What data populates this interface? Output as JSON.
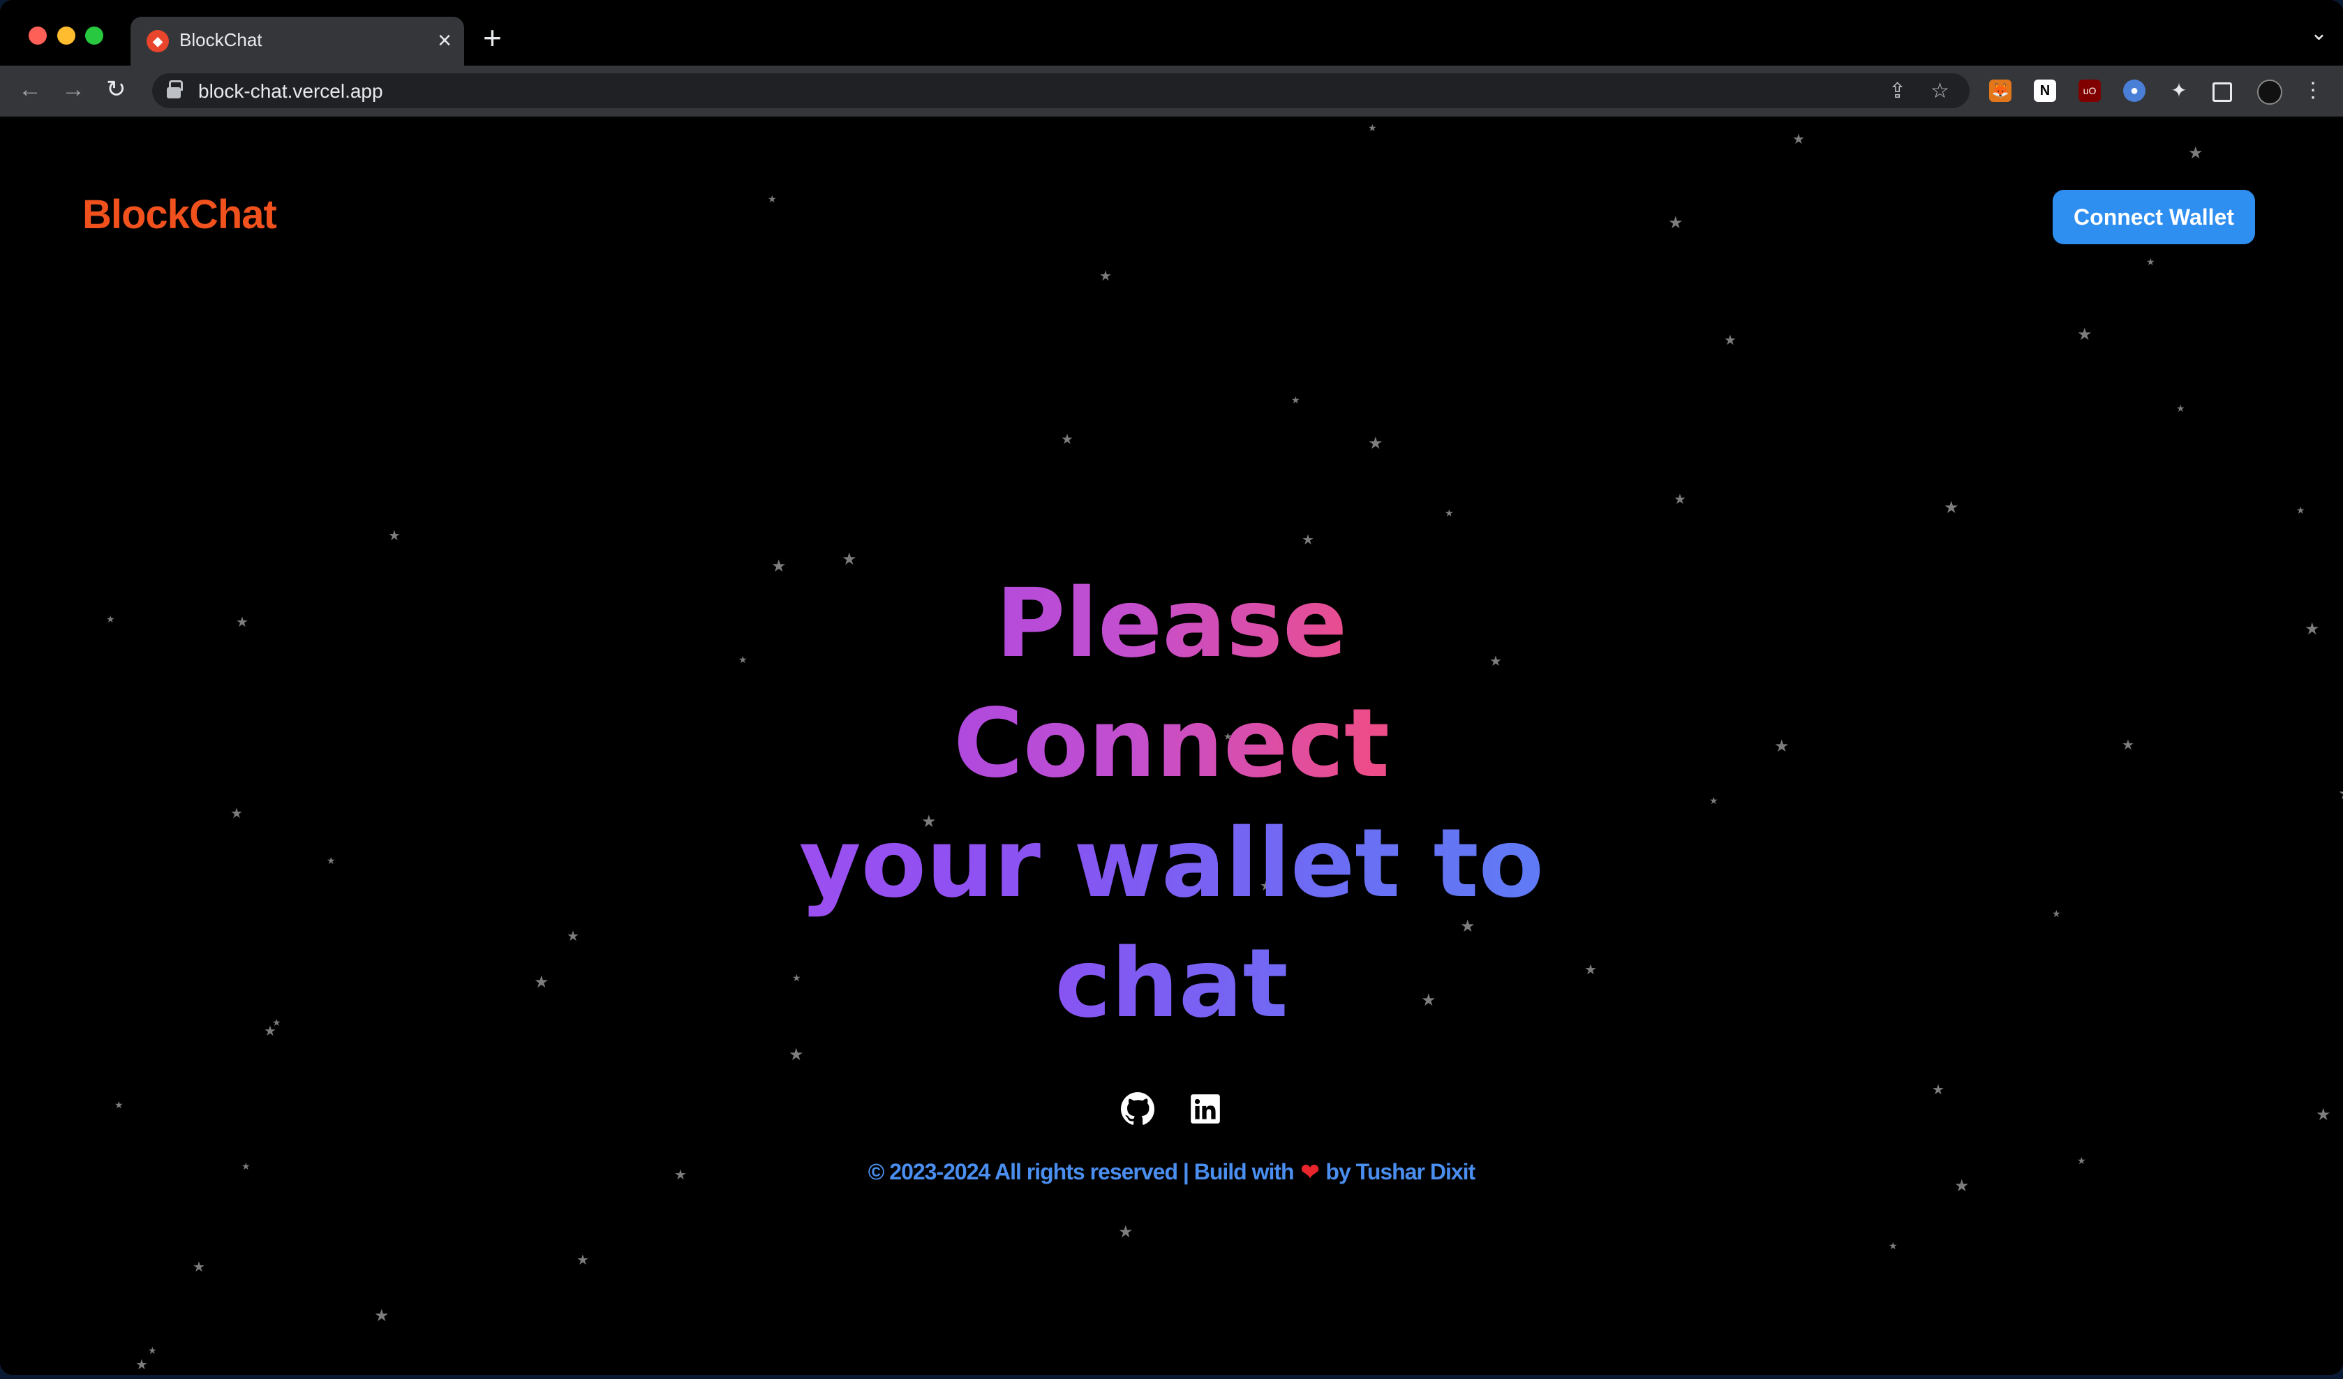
{
  "browser": {
    "tab_title": "BlockChat",
    "url": "block-chat.vercel.app",
    "new_tab_label": "+",
    "tab_close_label": "×"
  },
  "header": {
    "logo_text": "BlockChat",
    "connect_button_label": "Connect Wallet"
  },
  "hero": {
    "line1": "Please Connect",
    "line2": "your wallet to chat"
  },
  "footer": {
    "copyright": "© 2023-2024 All rights reserved | Build with",
    "by_label": "by",
    "author": "Tushar Dixit",
    "social_icons": [
      "github-icon",
      "linkedin-icon"
    ]
  },
  "colors": {
    "logo": "#f0511d",
    "button": "#2f8ff0",
    "footer_text": "#4a8ef0",
    "heart": "#e8262b"
  }
}
